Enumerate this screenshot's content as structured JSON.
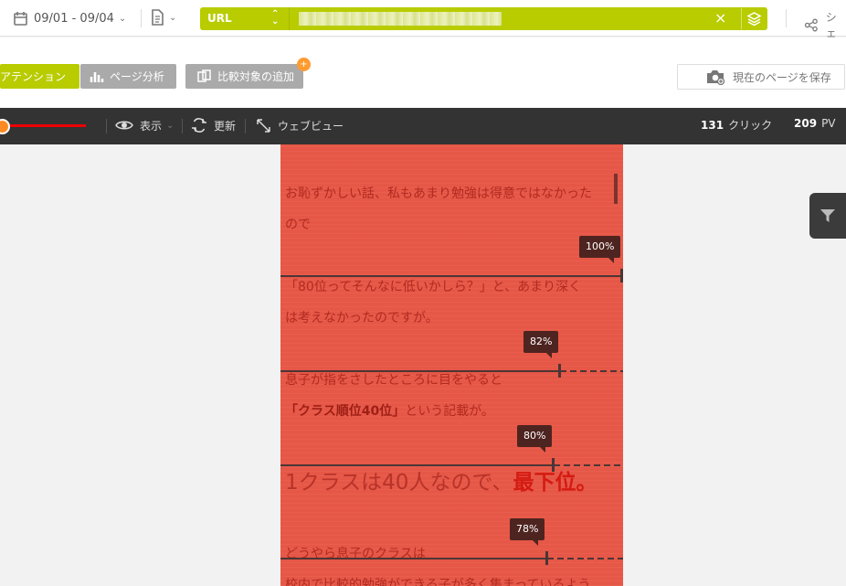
{
  "topbar": {
    "date_range": "09/01 - 09/04",
    "url_type": "URL",
    "url_value": "",
    "share_label": "シェ"
  },
  "toolbar": {
    "attention_label": "アテンション",
    "page_analysis_label": "ページ分析",
    "add_compare_label": "比較対象の追加",
    "save_page_label": "現在のページを保存",
    "compare_badge": "+"
  },
  "viewbar": {
    "display_label": "表示",
    "refresh_label": "更新",
    "webview_label": "ウェブビュー",
    "click_count": "131",
    "click_label": "クリック",
    "pv_count": "209",
    "pv_label": "PV"
  },
  "content": {
    "line_1": "お恥ずかしい話、私もあまり勉強は得意ではなかった",
    "line_2": "ので",
    "line_3": "「80位ってそんなに低いかしら？」と、あまり深く",
    "line_4": "は考えなかったのですが。",
    "line_5": "息子が指をさしたところに目をやると",
    "line_6_strong": "「クラス順位40位」",
    "line_6_text": "という記載が。",
    "line_7_text": "1クラスは40人なので、",
    "line_7_strong": "最下位。",
    "line_8": "どうやら息子のクラスは",
    "line_9": "校内で比較的勉強ができる子が多く集まっているよう"
  },
  "scroll_markers": [
    {
      "label": "100%",
      "value": 100
    },
    {
      "label": "82%",
      "value": 82
    },
    {
      "label": "80%",
      "value": 80
    },
    {
      "label": "78%",
      "value": 78
    }
  ],
  "icons": {
    "calendar": "calendar-icon",
    "document": "document-icon",
    "layers": "layers-icon",
    "share": "share-icon",
    "bar_chart": "bar-chart-icon",
    "copy": "copy-icon",
    "camera": "camera-icon",
    "eye": "eye-icon",
    "refresh": "refresh-icon",
    "resize": "resize-icon",
    "filter": "filter-icon"
  },
  "colors": {
    "accent": "#b8cc00",
    "heatmap": "#e95848",
    "toolbar_dark": "#333333",
    "badge": "#ff9b2f"
  }
}
